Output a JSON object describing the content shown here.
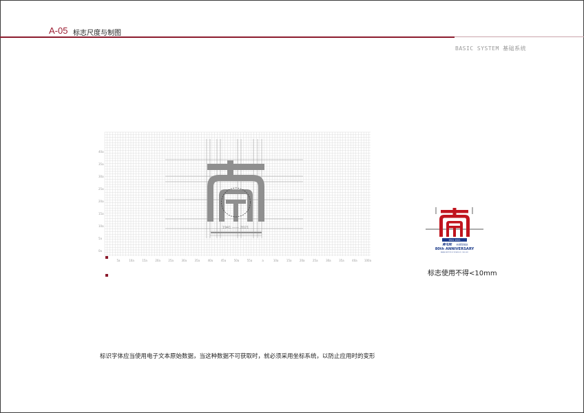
{
  "header": {
    "code": "A-05",
    "title": "标志尺度与制图",
    "section_label": "BASIC SYSTEM  基础系统"
  },
  "grid": {
    "y_labels": [
      "40a",
      "35a",
      "30a",
      "25a",
      "20a",
      "15a",
      "10a",
      "5a",
      "0a"
    ],
    "x_labels": [
      "5a",
      "10a",
      "15a",
      "20a",
      "25a",
      "30a",
      "35a",
      "40a",
      "45a",
      "50a",
      "55a",
      "a",
      "10a",
      "15a",
      "20a",
      "25a",
      "30a",
      "35a",
      "40a",
      "100a"
    ],
    "logo_years": "1941 —— 2021"
  },
  "mini_logo": {
    "years_tag": "1941   2021",
    "calligraphy": "南屯院",
    "anniv_cn": "80周年校庆",
    "anniv_en": "80th ANNIVERSARY",
    "tiny_line": "NANJING INSTITUTE OF TECHNOLOGY · 1941-2021",
    "caption": "标志使用不得<10mm"
  },
  "note": "标识字体应当使用电子文本原始数据，当这种数据不可获取时，就必须采用坐标系统，以防止应用时的变形",
  "colors": {
    "brand_red": "#c0141e",
    "navy": "#1b3a8a",
    "rule": "#8b1a2c",
    "grid_logo": "#8f8f8f"
  }
}
